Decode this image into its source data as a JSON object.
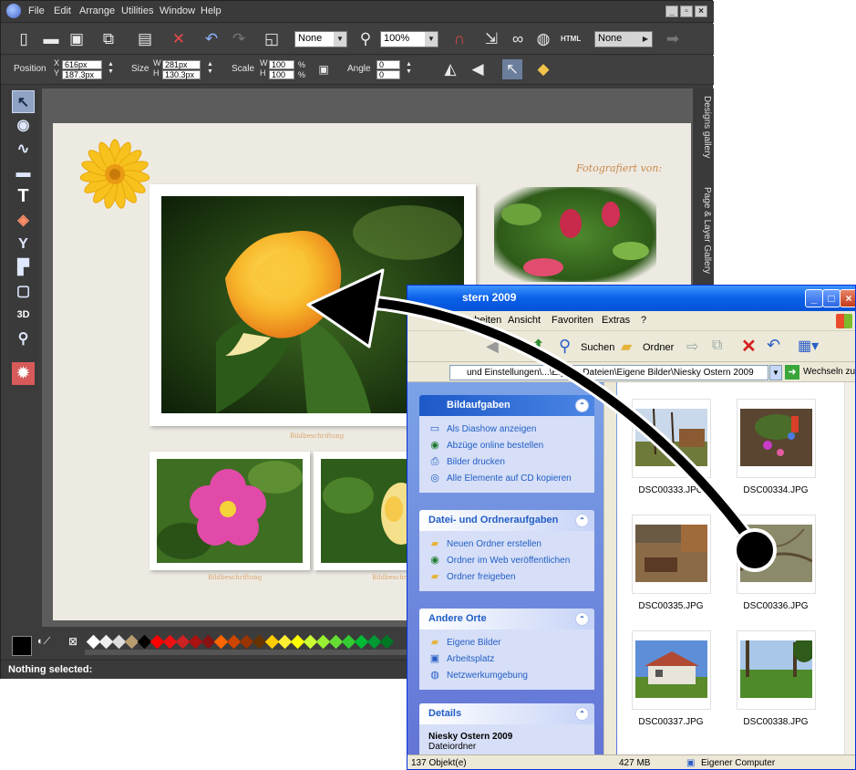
{
  "xara": {
    "menu": [
      "File",
      "Edit",
      "Arrange",
      "Utilities",
      "Window",
      "Help"
    ],
    "toolbar": {
      "fill_combo": "None",
      "zoom_combo": "100%",
      "html_label": "HTML",
      "style_combo": "None"
    },
    "infobar": {
      "position_label": "Position",
      "x_label": "X",
      "y_label": "Y",
      "x_value": "616px",
      "y_value": "187.3px",
      "size_label": "Size",
      "w_label": "W",
      "h_label": "H",
      "w_value": "281px",
      "h_value": "130.3px",
      "scale_label": "Scale",
      "scale_w": "100",
      "scale_h": "100",
      "percent": "%",
      "angle_label": "Angle",
      "angle_value": "0",
      "angle_value2": "0"
    },
    "tools": [
      "selector",
      "photo",
      "freehand",
      "rectangle",
      "text",
      "fill",
      "transparency",
      "shadow",
      "mould",
      "3d",
      "zoom",
      "colour"
    ],
    "three_d_label": "3D",
    "text_tool_label": "T",
    "canvas": {
      "heading": "Fotografiert von:",
      "captions": [
        "Bildbeschriftung",
        "Bildbeschriftung",
        "Bildbeschriftung"
      ]
    },
    "side_tabs": [
      "Designs gallery",
      "Page & Layer Gallery"
    ],
    "status": "Nothing selected:",
    "colors": {
      "palette": [
        "#ffffff",
        "#eeeeee",
        "#dddddd",
        "#b89c6e",
        "#000000",
        "#ff0000",
        "#ee1111",
        "#cc2222",
        "#aa1111",
        "#881111",
        "#ff6600",
        "#cc4400",
        "#993300",
        "#663300",
        "#ffcc00",
        "#ffee33",
        "#ffff00",
        "#ccff33",
        "#99ee33",
        "#66dd33",
        "#33cc33",
        "#00bb33",
        "#009933",
        "#007722"
      ]
    }
  },
  "explorer": {
    "title": "stern 2009",
    "menu": [
      "Bearbeiten",
      "Ansicht",
      "Favoriten",
      "Extras",
      "?"
    ],
    "toolbar": {
      "search": "Suchen",
      "folders": "Ordner"
    },
    "address": "und Einstellungen\\...\\Eigene Dateien\\Eigene Bilder\\Niesky Ostern 2009",
    "go_label": "Wechseln zu",
    "panels": [
      {
        "title": "Bildaufgaben",
        "tasks": [
          "Als Diashow anzeigen",
          "Abzüge online bestellen",
          "Bilder drucken",
          "Alle Elemente auf CD kopieren"
        ]
      },
      {
        "title": "Datei- und Ordneraufgaben",
        "tasks": [
          "Neuen Ordner erstellen",
          "Ordner im Web veröffentlichen",
          "Ordner freigeben"
        ]
      },
      {
        "title": "Andere Orte",
        "tasks": [
          "Eigene Bilder",
          "Arbeitsplatz",
          "Netzwerkumgebung"
        ]
      },
      {
        "title": "Details",
        "name": "Niesky Ostern 2009",
        "type": "Dateiordner"
      }
    ],
    "files": [
      "DSC00333.JPG",
      "DSC00334.JPG",
      "DSC00335.JPG",
      "DSC00336.JPG",
      "DSC00337.JPG",
      "DSC00338.JPG"
    ],
    "status": {
      "count": "137 Objekt(e)",
      "size": "427 MB",
      "location": "Eigener Computer"
    }
  }
}
